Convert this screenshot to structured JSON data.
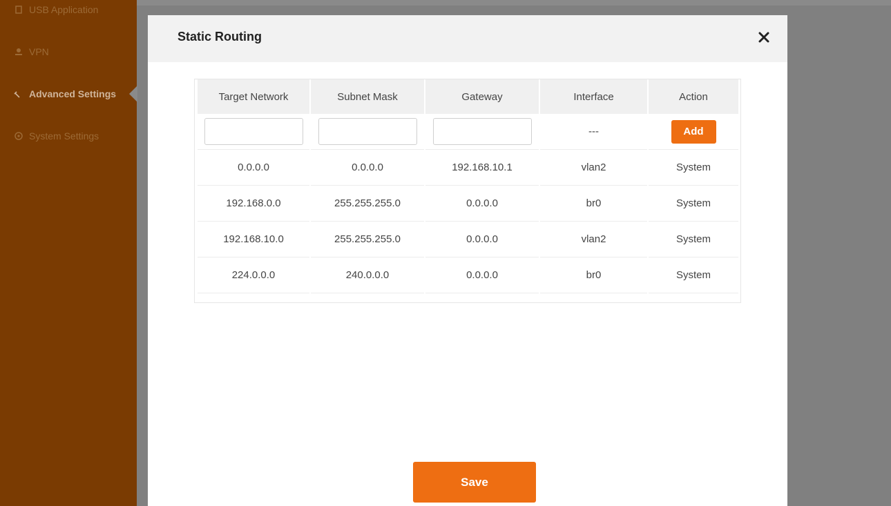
{
  "sidebar": {
    "items": [
      {
        "label": "USB Application",
        "icon": "usb-icon"
      },
      {
        "label": "VPN",
        "icon": "vpn-icon"
      },
      {
        "label": "Advanced Settings",
        "icon": "wrench-icon"
      },
      {
        "label": "System Settings",
        "icon": "gear-icon"
      }
    ]
  },
  "modal": {
    "title": "Static Routing",
    "close_label": "×"
  },
  "table": {
    "headers": [
      "Target Network",
      "Subnet Mask",
      "Gateway",
      "Interface",
      "Action"
    ],
    "new_row": {
      "target_network": "",
      "subnet_mask": "",
      "gateway": "",
      "interface": "---",
      "action_label": "Add"
    },
    "rows": [
      [
        "0.0.0.0",
        "0.0.0.0",
        "192.168.10.1",
        "vlan2",
        "System"
      ],
      [
        "192.168.0.0",
        "255.255.255.0",
        "0.0.0.0",
        "br0",
        "System"
      ],
      [
        "192.168.10.0",
        "255.255.255.0",
        "0.0.0.0",
        "vlan2",
        "System"
      ],
      [
        "224.0.0.0",
        "240.0.0.0",
        "0.0.0.0",
        "br0",
        "System"
      ]
    ]
  },
  "footer": {
    "save_label": "Save"
  },
  "colors": {
    "accent": "#ee6e12",
    "sidebar_bg": "#7a3b02",
    "overlay": "#808080"
  }
}
